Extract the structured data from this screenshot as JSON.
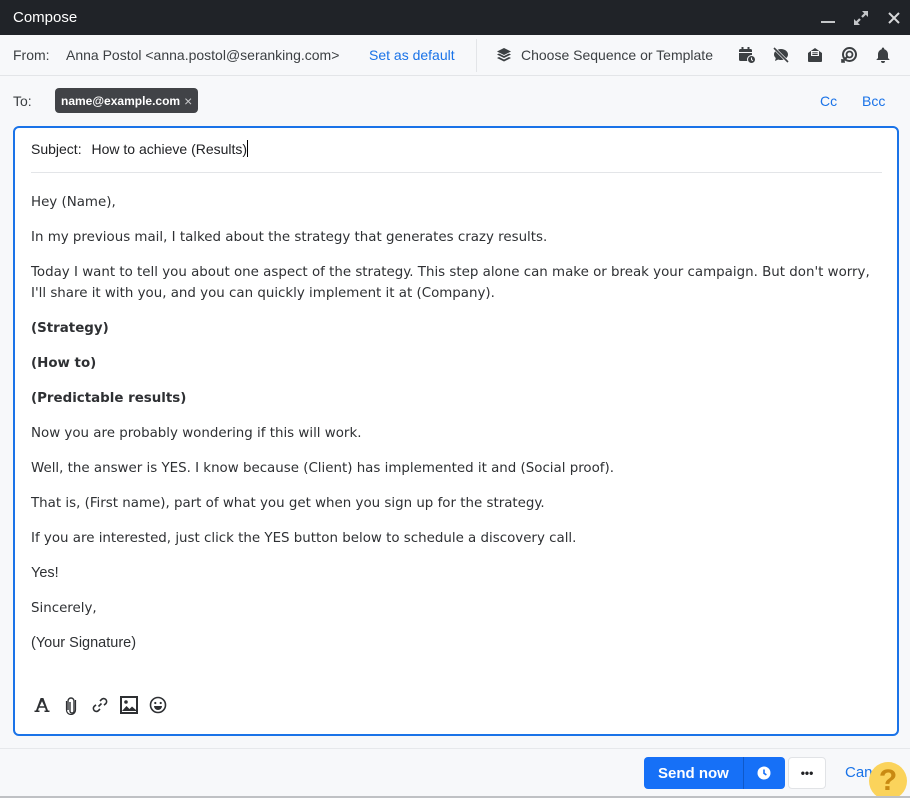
{
  "window": {
    "title": "Compose",
    "controls": [
      "minimize-icon",
      "expand-icon",
      "close-icon"
    ]
  },
  "from": {
    "label": "From:",
    "value": "Anna Postol <anna.postol@seranking.com>",
    "set_default": "Set as default"
  },
  "toolbar": {
    "sequence_label": "Choose Sequence or Template",
    "sequence_icon": "layers-icon",
    "icons": [
      "calendar-clock-icon",
      "tracking-off-icon",
      "envelope-open-icon",
      "target-icon",
      "bell-icon"
    ]
  },
  "to": {
    "label": "To:",
    "recipients": [
      {
        "email": "name@example.com",
        "remove": "×"
      }
    ],
    "cc": "Cc",
    "bcc": "Bcc"
  },
  "subject": {
    "label": "Subject:",
    "value": "How to achieve (Results)"
  },
  "body": {
    "paragraphs": [
      {
        "text": "Hey (Name),",
        "style": "normal"
      },
      {
        "text": "In my previous mail, I talked about the strategy that generates crazy results.",
        "style": "normal"
      },
      {
        "text": "Today I want to tell you about one aspect of the strategy. This step alone can make or break your campaign. But don't worry, I'll share it with you, and you can quickly implement it at (Company).",
        "style": "normal"
      },
      {
        "text": "(Strategy)",
        "style": "bold"
      },
      {
        "text": "(How to)",
        "style": "bold"
      },
      {
        "text": "(Predictable results)",
        "style": "bold"
      },
      {
        "text": "Now you are probably wondering if this will work.",
        "style": "normal"
      },
      {
        "text": "Well, the answer is YES. I know because (Client) has implemented it and (Social proof).",
        "style": "normal"
      },
      {
        "text": "That is, (First name), part of what you get when you sign up for the strategy.",
        "style": "normal"
      },
      {
        "text": "If you are interested, just click the YES button below to schedule a discovery call.",
        "style": "normal"
      },
      {
        "text": "Yes!",
        "style": "sans"
      },
      {
        "text": "Sincerely,",
        "style": "normal"
      },
      {
        "text": "(Your Signature)",
        "style": "sans"
      }
    ]
  },
  "format_bar": {
    "icons": [
      "text-format-icon",
      "attachment-icon",
      "link-icon",
      "image-icon",
      "emoji-icon"
    ]
  },
  "footer": {
    "send_now": "Send now",
    "schedule_icon": "clock-icon",
    "more": "•••",
    "cancel": "Can",
    "help": "?"
  },
  "colors": {
    "accent": "#1670f7",
    "titlebar": "#202328",
    "link": "#1a73e8",
    "chip": "#414347",
    "help": "#fbd35b"
  }
}
